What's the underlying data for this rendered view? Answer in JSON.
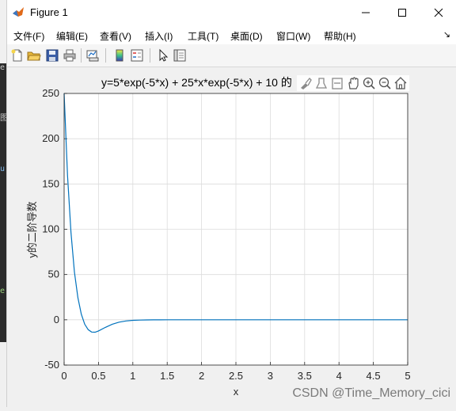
{
  "window": {
    "title": "Figure 1",
    "controls": [
      "minimize",
      "maximize",
      "close"
    ]
  },
  "menubar": {
    "items": [
      "文件(F)",
      "编辑(E)",
      "查看(V)",
      "插入(I)",
      "工具(T)",
      "桌面(D)",
      "窗口(W)",
      "帮助(H)"
    ],
    "overflow_arrow": "↘"
  },
  "toolbar": {
    "icons": [
      "new-figure-icon",
      "open-file-icon",
      "save-icon",
      "print-icon",
      "link-plot-icon",
      "colorbar-icon",
      "legend-icon",
      "pointer-icon",
      "property-inspector-icon"
    ]
  },
  "axes_toolbar": {
    "icons": [
      "brush-icon",
      "data-tips-icon",
      "rotate-icon",
      "pan-icon",
      "zoom-in-icon",
      "zoom-out-icon",
      "home-icon"
    ]
  },
  "watermark": "CSDN @Time_Memory_cici",
  "chart_data": {
    "type": "line",
    "title": "y=5*exp(-5*x) + 25*x*exp(-5*x) + 10 的",
    "xlabel": "x",
    "ylabel": "y的二阶导数",
    "xlim": [
      0,
      5
    ],
    "ylim": [
      -50,
      250
    ],
    "xticks": [
      "0",
      "0.5",
      "1",
      "1.5",
      "2",
      "2.5",
      "3",
      "3.5",
      "4",
      "4.5",
      "5"
    ],
    "yticks": [
      "-50",
      "0",
      "50",
      "100",
      "150",
      "200",
      "250"
    ],
    "grid": true,
    "series": [
      {
        "color": "#0072bd",
        "x": [
          0,
          0.05,
          0.1,
          0.15,
          0.2,
          0.25,
          0.3,
          0.35,
          0.4,
          0.45,
          0.5,
          0.6,
          0.7,
          0.8,
          0.9,
          1.0,
          1.1,
          1.2,
          1.3,
          1.4,
          1.5,
          1.6,
          1.8,
          2.0,
          2.5,
          3.0,
          3.5,
          4.0,
          4.5,
          5.0
        ],
        "y": [
          250,
          159.3,
          96.0,
          52.9,
          24.4,
          6.2,
          -4.9,
          -10.9,
          -13.5,
          -13.7,
          -12.3,
          -8.4,
          -4.9,
          -2.6,
          -1.3,
          -0.6,
          -0.28,
          -0.12,
          -0.05,
          -0.02,
          -0.01,
          0,
          0,
          0,
          0,
          0,
          0,
          0,
          0,
          0
        ]
      }
    ]
  }
}
